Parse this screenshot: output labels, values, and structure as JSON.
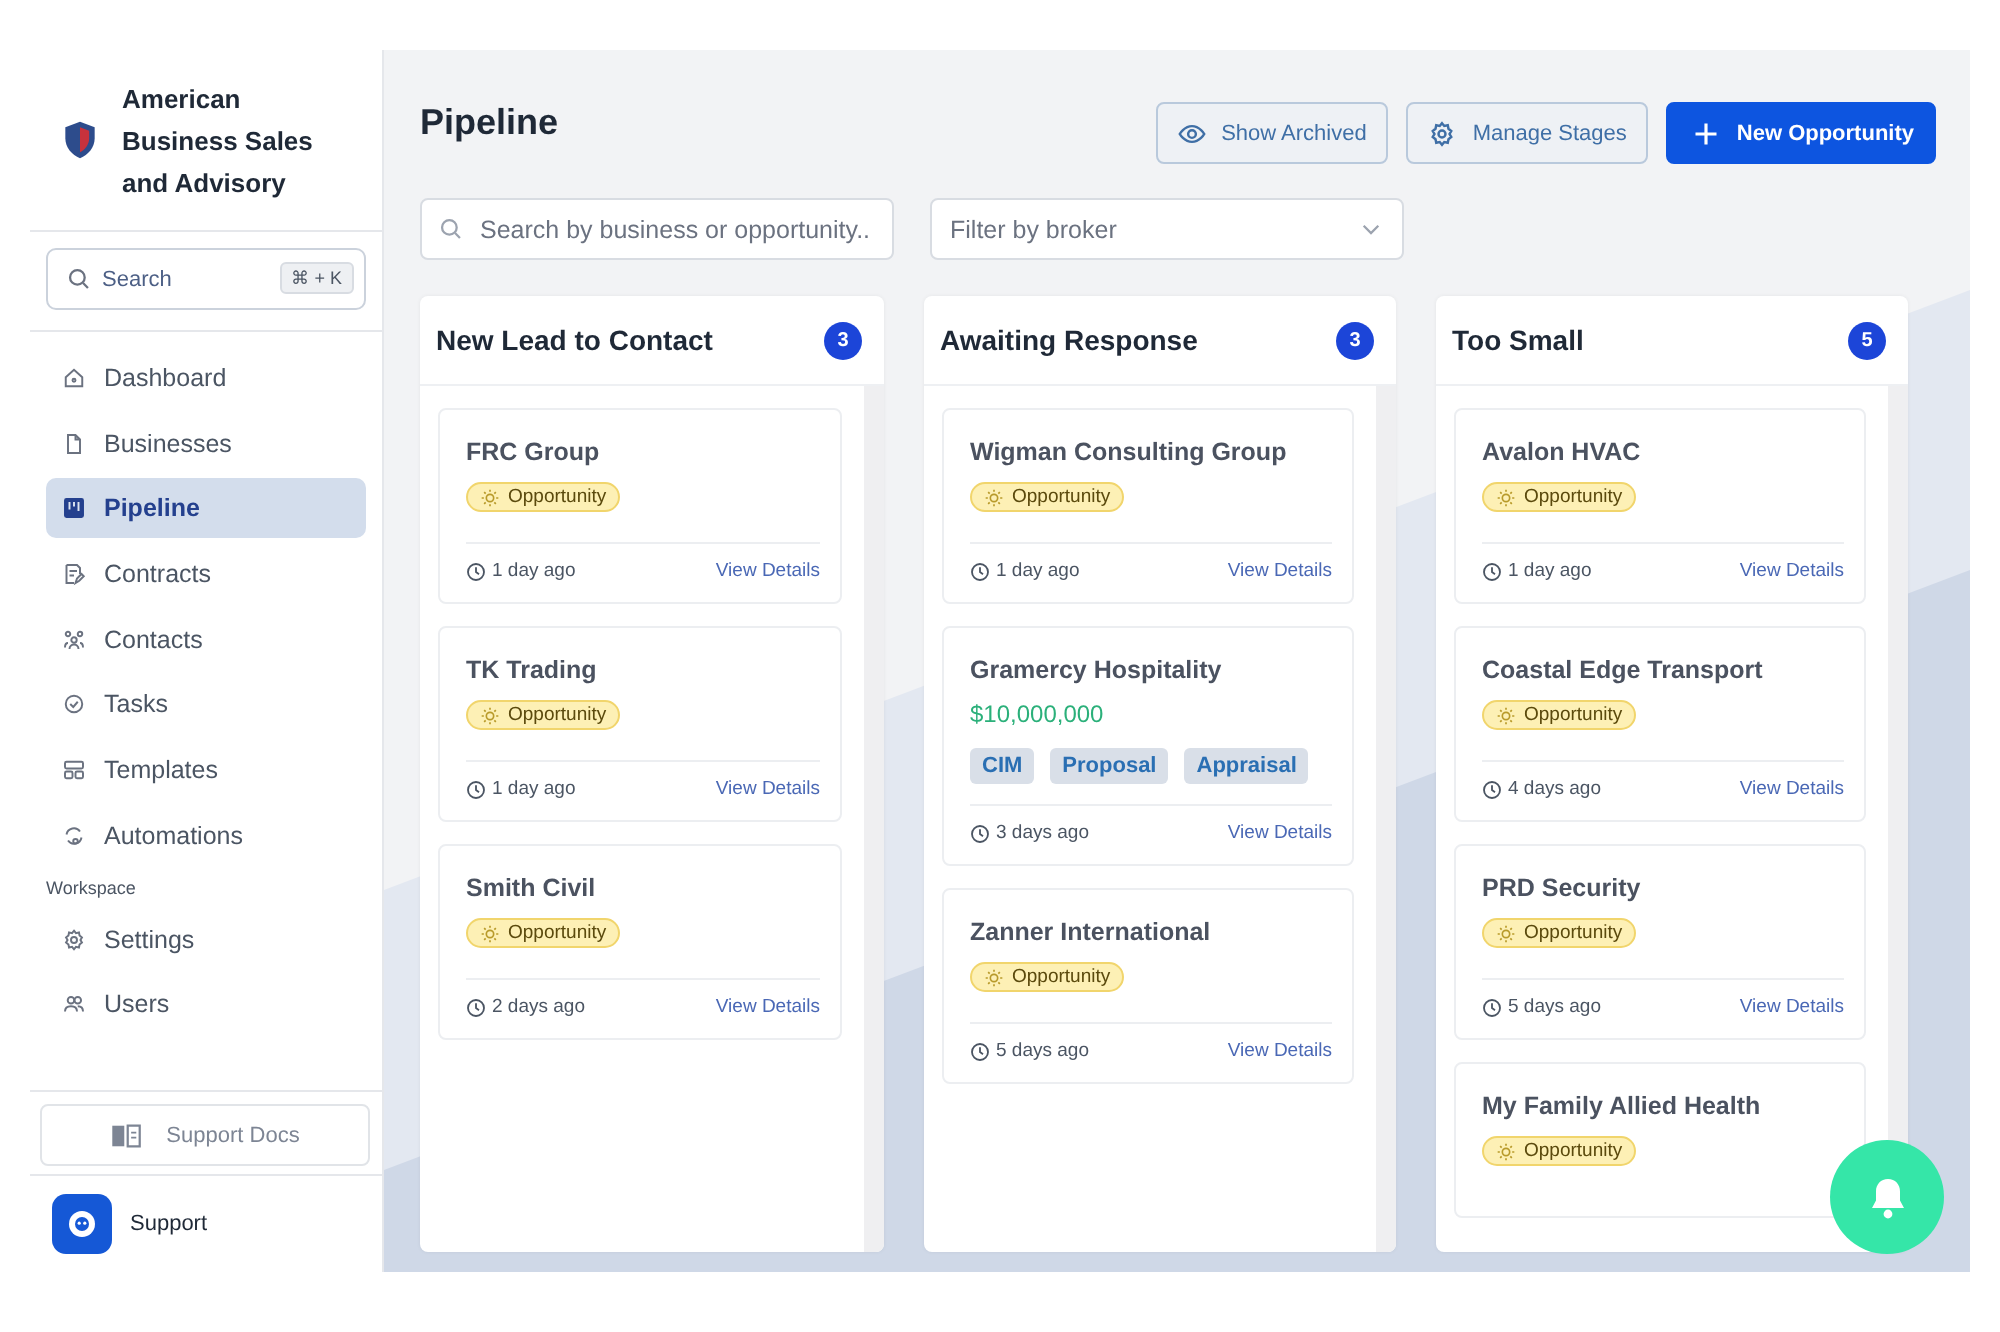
{
  "sidebar": {
    "brand": "American Business Sales and Advisory",
    "search": {
      "placeholder": "Search",
      "shortcut": "⌘ + K"
    },
    "nav": [
      {
        "label": "Dashboard",
        "selected": false
      },
      {
        "label": "Businesses",
        "selected": false
      },
      {
        "label": "Pipeline",
        "selected": true
      },
      {
        "label": "Contracts",
        "selected": false
      },
      {
        "label": "Contacts",
        "selected": false
      },
      {
        "label": "Tasks",
        "selected": false
      },
      {
        "label": "Templates",
        "selected": false
      },
      {
        "label": "Automations",
        "selected": false
      }
    ],
    "workspace": {
      "label": "Workspace",
      "items": [
        {
          "label": "Settings",
          "selected": false
        },
        {
          "label": "Users",
          "selected": false
        }
      ]
    },
    "docs_button": "Support Docs",
    "support": "Support"
  },
  "page": {
    "title": "Pipeline",
    "buttons": [
      {
        "kind": "outline",
        "label": "Show Archived"
      },
      {
        "kind": "outline",
        "label": "Manage Stages"
      },
      {
        "kind": "primary",
        "label": "New Opportunity"
      }
    ],
    "search": {
      "placeholder": "Search by business or opportunity.."
    },
    "broker_filter": {
      "placeholder": "Filter by broker"
    }
  },
  "columns": [
    {
      "title": "New Lead to Contact",
      "count": "3",
      "cards": [
        {
          "name": "FRC Group",
          "badge": "Opportunity",
          "time": "1 day ago",
          "link": "View Details"
        },
        {
          "name": "TK Trading",
          "badge": "Opportunity",
          "time": "1 day ago",
          "link": "View Details"
        },
        {
          "name": "Smith Civil",
          "badge": "Opportunity",
          "time": "2 days ago",
          "link": "View Details"
        }
      ]
    },
    {
      "title": "Awaiting Response",
      "count": "3",
      "cards": [
        {
          "name": "Wigman Consulting Group",
          "badge": "Opportunity",
          "time": "1 day ago",
          "link": "View Details"
        },
        {
          "name": "Gramercy Hospitality",
          "amount": "$10,000,000",
          "tags": [
            "CIM",
            "Proposal",
            "Appraisal"
          ],
          "time": "3 days ago",
          "link": "View Details"
        },
        {
          "name": "Zanner International",
          "badge": "Opportunity",
          "time": "5 days ago",
          "link": "View Details"
        }
      ]
    },
    {
      "title": "Too Small",
      "count": "5",
      "cards": [
        {
          "name": "Avalon HVAC",
          "badge": "Opportunity",
          "time": "1 day ago",
          "link": "View Details"
        },
        {
          "name": "Coastal Edge Transport",
          "badge": "Opportunity",
          "time": "4 days ago",
          "link": "View Details"
        },
        {
          "name": "PRD Security",
          "badge": "Opportunity",
          "time": "5 days ago",
          "link": "View Details"
        },
        {
          "name": "My Family Allied Health",
          "badge": "Opportunity"
        }
      ]
    }
  ]
}
